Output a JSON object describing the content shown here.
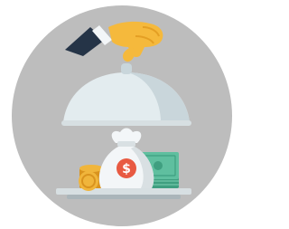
{
  "illustration": {
    "money_bag_symbol": "$",
    "icon": "cloche-reveal-money",
    "colors": {
      "background_circle": "#bdbdbd",
      "sleeve": "#253447",
      "cuff": "#f3f6f8",
      "hand": "#f5b93c",
      "hand_shade": "#e49f24",
      "cloche": "#e3ecef",
      "cloche_shade": "#c9d6db",
      "tray": "#d7dfe2",
      "tray_shade": "#aab5ba",
      "bag": "#f3f6f8",
      "bag_shade": "#d9e0e3",
      "dollar_badge": "#e85a42",
      "bill_light": "#5fbf9f",
      "bill_dark": "#3f9f80",
      "coin": "#f0b53b",
      "coin_dark": "#d9931e"
    }
  }
}
